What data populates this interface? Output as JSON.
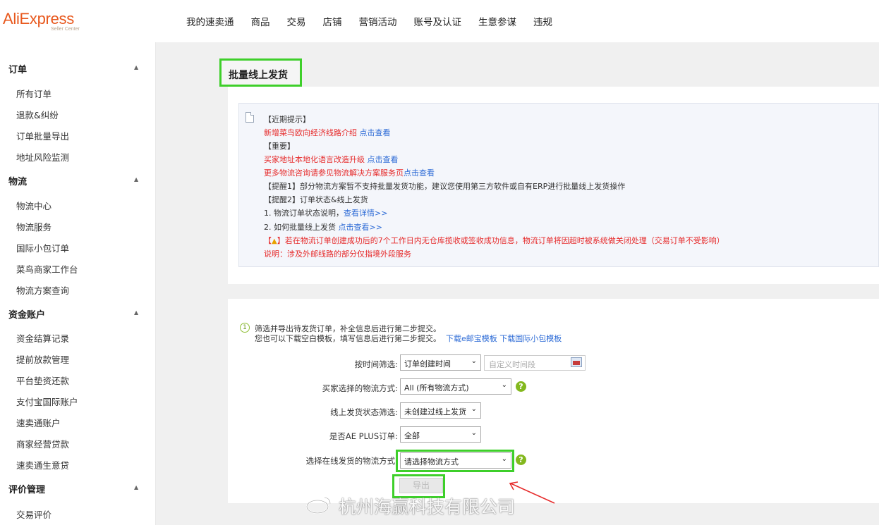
{
  "brand": {
    "name": "AliExpress",
    "subtitle": "Seller Center"
  },
  "nav": [
    "我的速卖通",
    "商品",
    "交易",
    "店铺",
    "营销活动",
    "账号及认证",
    "生意参谋",
    "违规"
  ],
  "sidebar": {
    "sections": [
      {
        "label": "订单",
        "items": [
          "所有订单",
          "退款&纠纷",
          "订单批量导出",
          "地址风险监测"
        ]
      },
      {
        "label": "物流",
        "items": [
          "物流中心",
          "物流服务",
          "国际小包订单",
          "菜鸟商家工作台",
          "物流方案查询"
        ]
      },
      {
        "label": "资金账户",
        "items": [
          "资金结算记录",
          "提前放款管理",
          "平台垫资还款",
          "支付宝国际账户",
          "速卖通账户",
          "商家经营贷款",
          "速卖通生意贷"
        ]
      },
      {
        "label": "评价管理",
        "items": [
          "交易评价"
        ]
      }
    ]
  },
  "page_title": "批量线上发货",
  "notice": {
    "recent_header": "【近期提示】",
    "recent_line": "新增菜鸟欧向经济线路介绍",
    "recent_link": "点击查看",
    "important_header": "【重要】",
    "important_line1": "买家地址本地化语言改造升级",
    "important_link1": "点击查看",
    "important_line2": "更多物流咨询请参见物流解决方案服务页",
    "important_link2": "点击查看",
    "reminder1": "【提醒1】部分物流方案暂不支持批量发货功能，建议您使用第三方软件或自有ERP进行批量线上发货操作",
    "reminder2": "【提醒2】订单状态&线上发货",
    "item1_text": "1. 物流订单状态说明，",
    "item1_link": "查看详情>>",
    "item2_text": "2. 如何批量线上发货",
    "item2_link": "点击查看>>",
    "warning_prefix": "【",
    "warning_suffix": "】若在物流订单创建成功后的7个工作日内无仓库揽收或签收成功信息，物流订单将因超时被系统做关闭处理（交易订单不受影响）",
    "note": "说明：涉及外邮线路的部分仅指境外段服务"
  },
  "filter": {
    "step_number": "1",
    "step_line1": "筛选并导出待发货订单，补全信息后进行第二步提交。",
    "step_line2": "您也可以下载空白模板，填写信息后进行第二步提交。",
    "template_link1": "下载e邮宝模板",
    "template_link2": "下载国际小包模板",
    "time_label": "按时间筛选:",
    "time_value": "订单创建时间",
    "date_placeholder": "自定义时间段",
    "buyer_shipping_label": "买家选择的物流方式:",
    "buyer_shipping_value": "All (所有物流方式)",
    "online_status_label": "线上发货状态筛选:",
    "online_status_value": "未创建过线上发货",
    "ae_plus_label": "是否AE PLUS订单:",
    "ae_plus_value": "全部",
    "shipping_method_label": "选择在线发货的物流方式:",
    "shipping_method_value": "请选择物流方式",
    "export_label": "导出",
    "help_glyph": "?"
  },
  "watermark": "杭州海赢科技有限公司",
  "colors": {
    "highlight": "#3ecf2a",
    "brand": "#e8581d",
    "link": "#2d6bd6",
    "alert": "#e62b2b"
  }
}
